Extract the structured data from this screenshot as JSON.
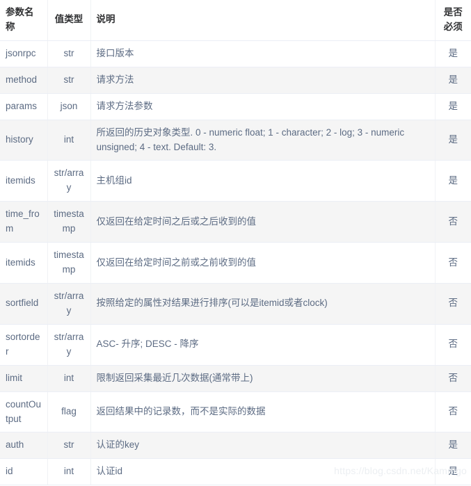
{
  "table": {
    "columns": [
      {
        "key": "name",
        "label": "参数名称"
      },
      {
        "key": "type",
        "label": "值类型"
      },
      {
        "key": "desc",
        "label": "说明"
      },
      {
        "key": "req",
        "label": "是否必须"
      }
    ],
    "rows": [
      {
        "name": "jsonrpc",
        "type": "str",
        "desc": "接口版本",
        "req": "是"
      },
      {
        "name": "method",
        "type": "str",
        "desc": "请求方法",
        "req": "是"
      },
      {
        "name": "params",
        "type": "json",
        "desc": "请求方法参数",
        "req": "是"
      },
      {
        "name": "history",
        "type": "int",
        "desc": "所返回的历史对象类型. 0 - numeric float; 1 - character; 2 - log; 3 - numeric unsigned; 4 - text. Default: 3.",
        "req": "是"
      },
      {
        "name": "itemids",
        "type": "str/array",
        "desc": "主机组id",
        "req": "是"
      },
      {
        "name": "time_from",
        "type": "timestamp",
        "desc": "仅返回在给定时间之后或之后收到的值",
        "req": "否"
      },
      {
        "name": "itemids",
        "type": "timestamp",
        "desc": "仅返回在给定时间之前或之前收到的值",
        "req": "否"
      },
      {
        "name": "sortfield",
        "type": "str/array",
        "desc": "按照给定的属性对结果进行排序(可以是itemid或者clock)",
        "req": "否"
      },
      {
        "name": "sortorder",
        "type": "str/array",
        "desc": "ASC- 升序; DESC - 降序",
        "req": "否"
      },
      {
        "name": "limit",
        "type": "int",
        "desc": "限制返回采集最近几次数据(通常带上)",
        "req": "否"
      },
      {
        "name": "countOutput",
        "type": "flag",
        "desc": "返回结果中的记录数，而不是实际的数据",
        "req": "否"
      },
      {
        "name": "auth",
        "type": "str",
        "desc": "认证的key",
        "req": "是"
      },
      {
        "name": "id",
        "type": "int",
        "desc": "认证id",
        "req": "是"
      }
    ]
  },
  "watermark": {
    "text": "https://blog.csdn.net/Kammgo"
  },
  "colors": {
    "header_text": "#303133",
    "body_text": "#5c6b83",
    "border": "#ebeef5",
    "stripe_bg": "#f5f5f5",
    "plain_bg": "#ffffff",
    "watermark": "#eceff2"
  }
}
